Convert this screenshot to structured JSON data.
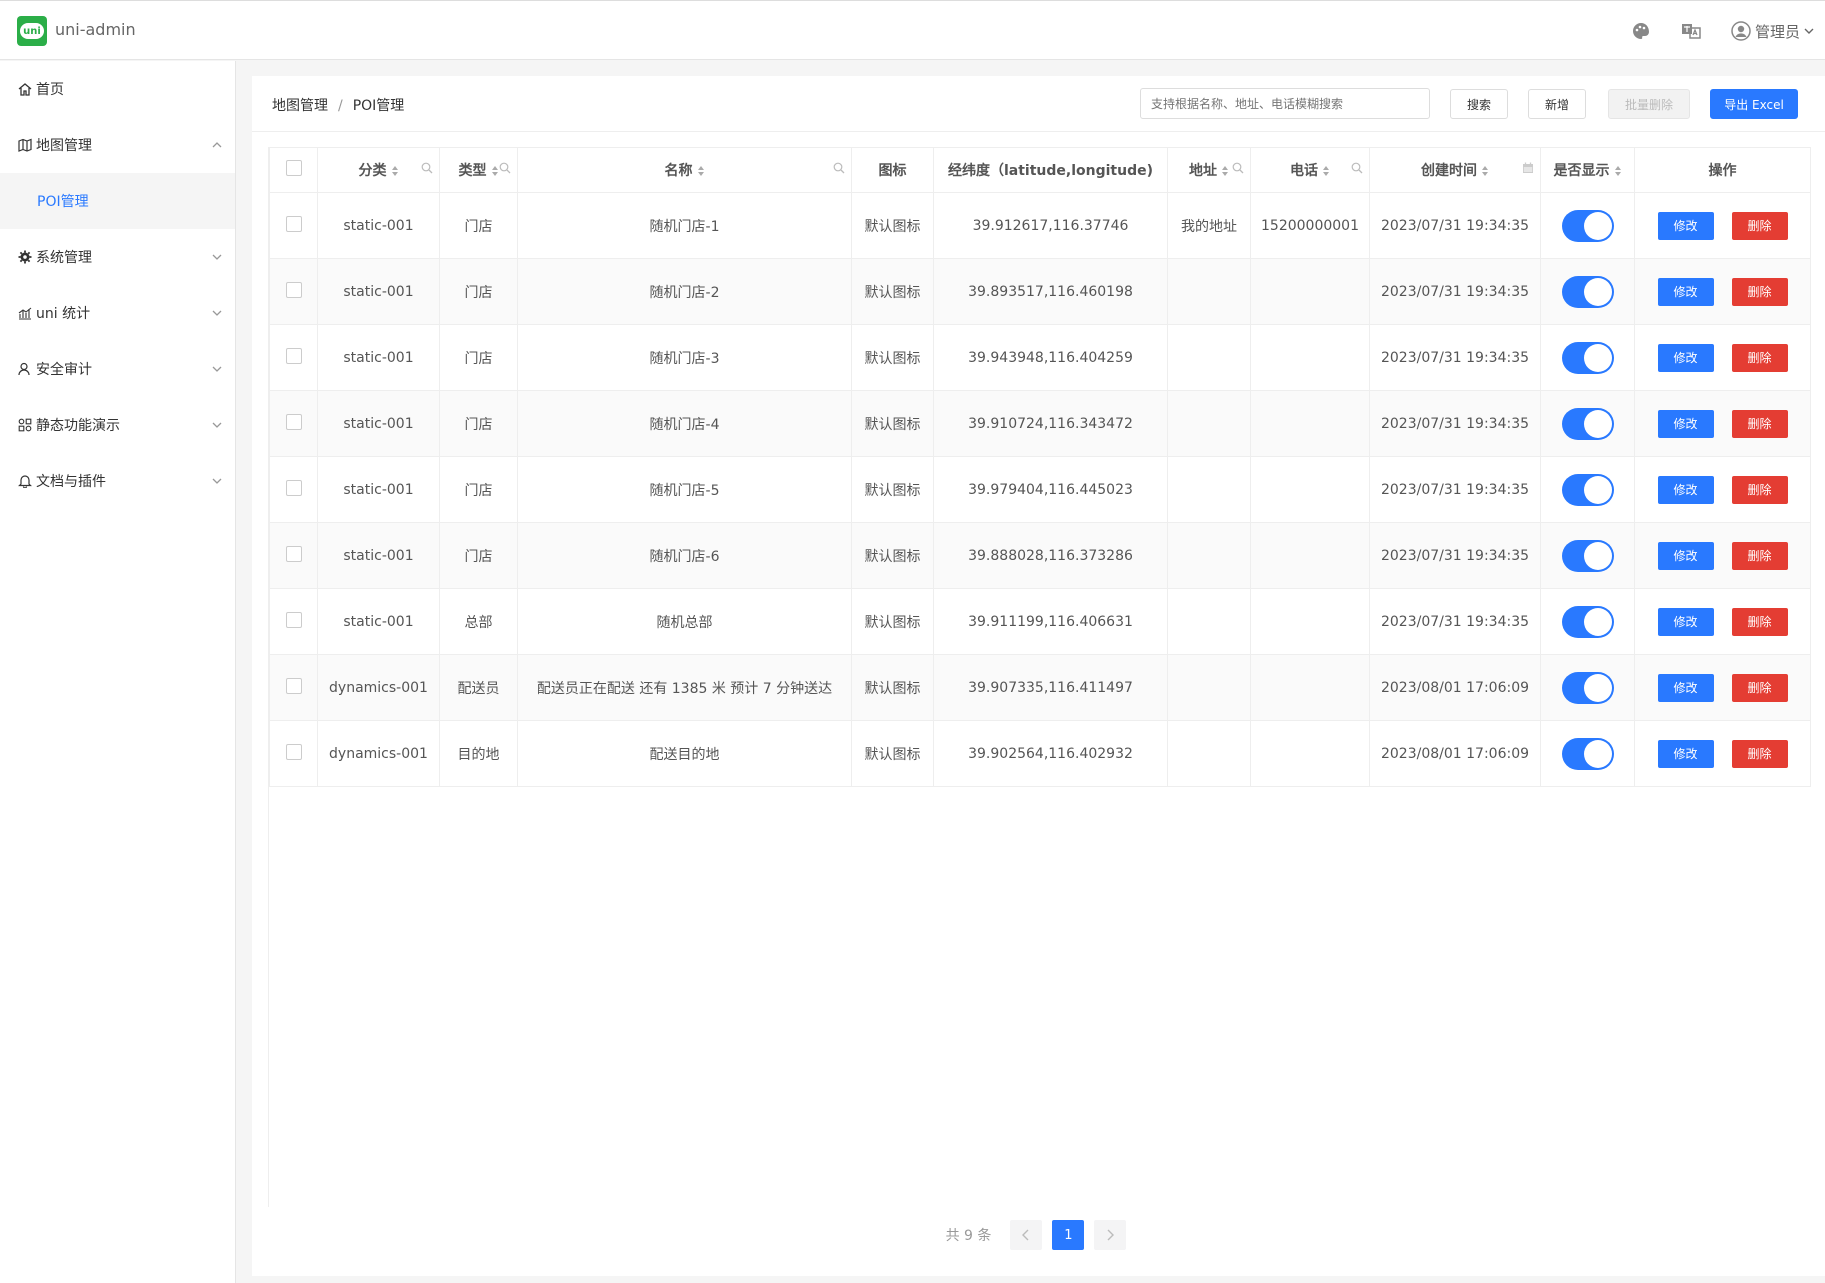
{
  "app": {
    "logo_text": "uni",
    "title": "uni-admin"
  },
  "header": {
    "user_name": "管理员"
  },
  "sidebar": {
    "items": [
      {
        "label": "首页"
      },
      {
        "label": "地图管理"
      },
      {
        "label": "POI管理"
      },
      {
        "label": "系统管理"
      },
      {
        "label": "uni 统计"
      },
      {
        "label": "安全审计"
      },
      {
        "label": "静态功能演示"
      },
      {
        "label": "文档与插件"
      }
    ]
  },
  "breadcrumb": {
    "parent": "地图管理",
    "sep": "/",
    "current": "POI管理"
  },
  "toolbar": {
    "search_placeholder": "支持根据名称、地址、电话模糊搜索",
    "search_label": "搜索",
    "add_label": "新增",
    "batch_delete_label": "批量删除",
    "export_label": "导出 Excel"
  },
  "table": {
    "columns": [
      "分类",
      "类型",
      "名称",
      "图标",
      "经纬度（latitude,longitude)",
      "地址",
      "电话",
      "创建时间",
      "是否显示",
      "操作"
    ],
    "rows": [
      {
        "category": "static-001",
        "type": "门店",
        "name": "随机门店-1",
        "icon": "默认图标",
        "location": "39.912617,116.37746",
        "address": "我的地址",
        "phone": "15200000001",
        "created": "2023/07/31 19:34:35"
      },
      {
        "category": "static-001",
        "type": "门店",
        "name": "随机门店-2",
        "icon": "默认图标",
        "location": "39.893517,116.460198",
        "address": "",
        "phone": "",
        "created": "2023/07/31 19:34:35"
      },
      {
        "category": "static-001",
        "type": "门店",
        "name": "随机门店-3",
        "icon": "默认图标",
        "location": "39.943948,116.404259",
        "address": "",
        "phone": "",
        "created": "2023/07/31 19:34:35"
      },
      {
        "category": "static-001",
        "type": "门店",
        "name": "随机门店-4",
        "icon": "默认图标",
        "location": "39.910724,116.343472",
        "address": "",
        "phone": "",
        "created": "2023/07/31 19:34:35"
      },
      {
        "category": "static-001",
        "type": "门店",
        "name": "随机门店-5",
        "icon": "默认图标",
        "location": "39.979404,116.445023",
        "address": "",
        "phone": "",
        "created": "2023/07/31 19:34:35"
      },
      {
        "category": "static-001",
        "type": "门店",
        "name": "随机门店-6",
        "icon": "默认图标",
        "location": "39.888028,116.373286",
        "address": "",
        "phone": "",
        "created": "2023/07/31 19:34:35"
      },
      {
        "category": "static-001",
        "type": "总部",
        "name": "随机总部",
        "icon": "默认图标",
        "location": "39.911199,116.406631",
        "address": "",
        "phone": "",
        "created": "2023/07/31 19:34:35"
      },
      {
        "category": "dynamics-001",
        "type": "配送员",
        "name": "配送员正在配送 还有 1385 米 预计 7 分钟送达",
        "icon": "默认图标",
        "location": "39.907335,116.411497",
        "address": "",
        "phone": "",
        "created": "2023/08/01 17:06:09"
      },
      {
        "category": "dynamics-001",
        "type": "目的地",
        "name": "配送目的地",
        "icon": "默认图标",
        "location": "39.902564,116.402932",
        "address": "",
        "phone": "",
        "created": "2023/08/01 17:06:09"
      }
    ],
    "edit_label": "修改",
    "delete_label": "删除"
  },
  "pagination": {
    "total_text": "共 9 条",
    "current_page": "1"
  }
}
